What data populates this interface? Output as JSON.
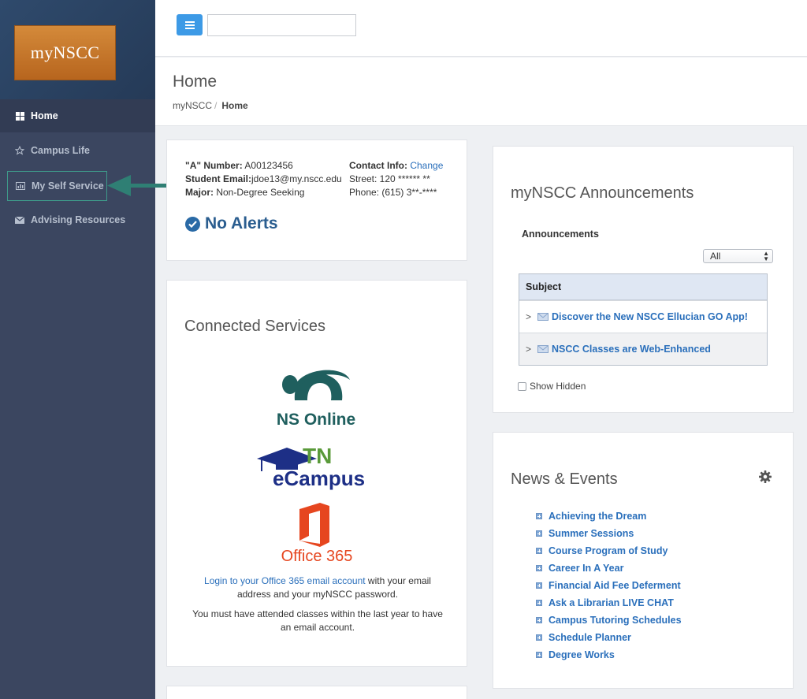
{
  "brand": {
    "logo_text": "myNSCC"
  },
  "sidebar": {
    "items": [
      {
        "label": "Home",
        "icon": "grid-icon"
      },
      {
        "label": "Campus Life",
        "icon": "star-icon"
      },
      {
        "label": "My Self Service",
        "icon": "bar-chart-icon"
      },
      {
        "label": "Advising Resources",
        "icon": "envelope-icon"
      }
    ]
  },
  "search": {
    "placeholder": ""
  },
  "header": {
    "title": "Home",
    "breadcrumb": {
      "root": "myNSCC",
      "separator": "/",
      "current": "Home"
    }
  },
  "profile": {
    "a_number_label": "\"A\" Number:",
    "a_number": "A00123456",
    "email_label": "Student Email:",
    "email": "jdoe13@my.nscc.edu",
    "major_label": "Major:",
    "major": "Non-Degree Seeking",
    "contact_label": "Contact Info:",
    "contact_change": "Change",
    "street": "Street: 120 ****** **",
    "phone": "Phone: (615) 3**-****",
    "alerts": "No Alerts"
  },
  "services": {
    "title": "Connected Services",
    "ns_online": "NS Online",
    "tn": "TN",
    "ecampus": "eCampus",
    "office365": "Office 365",
    "login_link": "Login to your Office 365 email account",
    "login_rest": " with your email address and your myNSCC password.",
    "note": "You must have attended classes within the last year to have an email account."
  },
  "announcements": {
    "title": "myNSCC Announcements",
    "label": "Announcements",
    "filter_value": "All",
    "column_subject": "Subject",
    "rows": [
      "Discover the New NSCC Ellucian GO App!",
      "NSCC Classes are Web-Enhanced"
    ],
    "show_hidden": "Show Hidden"
  },
  "news": {
    "title": "News & Events",
    "items": [
      "Achieving the Dream",
      "Summer Sessions",
      "Course Program of Study",
      "Career In A Year",
      "Financial Aid Fee Deferment",
      "Ask a Librarian LIVE CHAT",
      "Campus Tutoring Schedules",
      "Schedule Planner",
      "Degree Works"
    ]
  },
  "colors": {
    "sidebar_bg": "#3b4660",
    "accent_blue": "#3d9ae6",
    "link": "#2a6fbb",
    "annotation_arrow": "#2f7f74"
  }
}
